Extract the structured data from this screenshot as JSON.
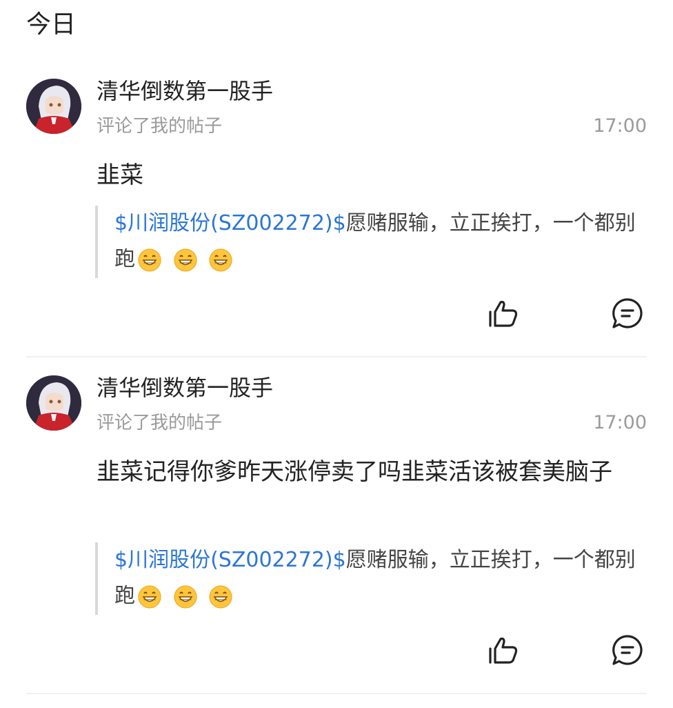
{
  "section": {
    "title": "今日"
  },
  "notifications": [
    {
      "username": "清华倒数第一股手",
      "action": "评论了我的帖子",
      "time": "17:00",
      "comment": "韭菜",
      "quote": {
        "stock": "$川润股份(SZ002272)$",
        "text": "愿赌服输，立正挨打，一个都别跑",
        "emojis": [
          "grin-emoji",
          "grin-emoji",
          "grin-emoji"
        ]
      },
      "icons": {
        "like": "thumbs-up-icon",
        "reply": "chat-bubble-icon"
      }
    },
    {
      "username": "清华倒数第一股手",
      "action": "评论了我的帖子",
      "time": "17:00",
      "comment": "韭菜记得你爹昨天涨停卖了吗韭菜活该被套美脑子",
      "quote": {
        "stock": "$川润股份(SZ002272)$",
        "text": "愿赌服输，立正挨打，一个都别跑",
        "emojis": [
          "grin-emoji",
          "grin-emoji",
          "grin-emoji"
        ]
      },
      "icons": {
        "like": "thumbs-up-icon",
        "reply": "chat-bubble-icon"
      }
    }
  ],
  "colors": {
    "link": "#2a76d6",
    "muted": "#9a9a9a",
    "text": "#222222",
    "quote_border": "#d8d8d8"
  }
}
